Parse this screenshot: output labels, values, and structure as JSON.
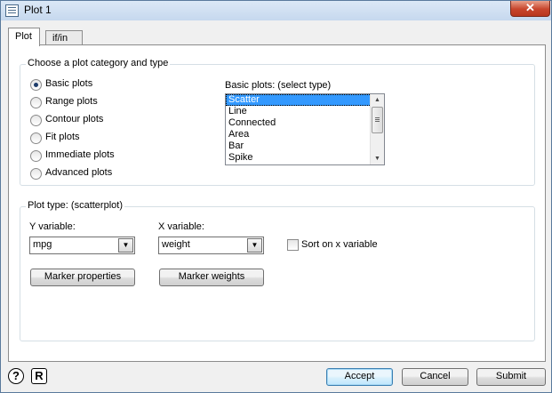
{
  "window": {
    "title": "Plot 1",
    "close_label": "✕"
  },
  "tabs": [
    {
      "label": "Plot"
    },
    {
      "label": "if/in"
    }
  ],
  "category_group": {
    "title": "Choose a plot category and type",
    "options": [
      {
        "label": "Basic plots",
        "selected": true
      },
      {
        "label": "Range plots",
        "selected": false
      },
      {
        "label": "Contour plots",
        "selected": false
      },
      {
        "label": "Fit plots",
        "selected": false
      },
      {
        "label": "Immediate plots",
        "selected": false
      },
      {
        "label": "Advanced plots",
        "selected": false
      }
    ],
    "list_label": "Basic plots: (select type)",
    "list_items": [
      "Scatter",
      "Line",
      "Connected",
      "Area",
      "Bar",
      "Spike"
    ],
    "selected_item": "Scatter"
  },
  "plot_type_group": {
    "title": "Plot type: (scatterplot)",
    "y_label": "Y variable:",
    "y_value": "mpg",
    "x_label": "X variable:",
    "x_value": "weight",
    "sort_label": "Sort on x variable",
    "sort_checked": false,
    "marker_properties": "Marker properties",
    "marker_weights": "Marker weights"
  },
  "footer": {
    "help_icon": "?",
    "reset_icon": "R",
    "accept": "Accept",
    "cancel": "Cancel",
    "submit": "Submit"
  }
}
